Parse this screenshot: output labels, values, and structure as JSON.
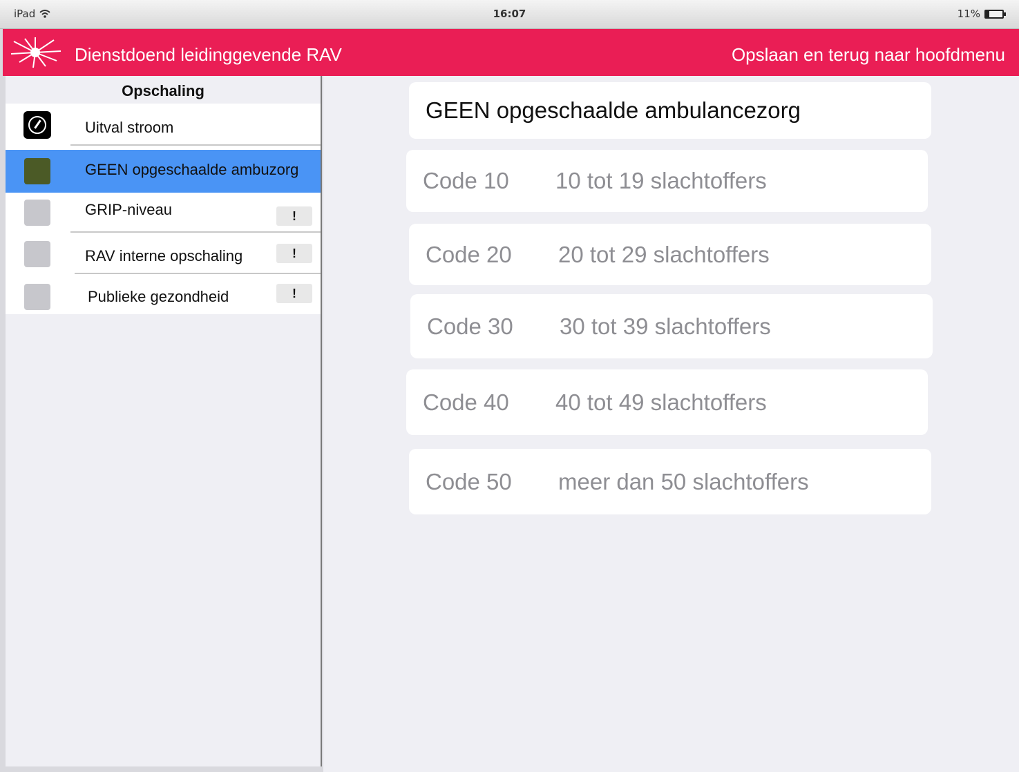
{
  "status_bar": {
    "device": "iPad",
    "time": "16:07",
    "battery": "11%"
  },
  "header": {
    "title": "Dienstdoend leidinggevende RAV",
    "save_back": "Opslaan en terug naar hoofdmenu",
    "accent_color": "#ea1e55"
  },
  "sidebar": {
    "heading": "Opschaling",
    "items": [
      {
        "label": "Uitval stroom",
        "icon": "compass-icon",
        "warning": false,
        "selected": false
      },
      {
        "label": "GEEN opgeschaalde ambuzorg",
        "icon": "olive-square",
        "warning": false,
        "selected": true
      },
      {
        "label": "GRIP-niveau",
        "icon": "gray-square",
        "warning": true,
        "selected": false
      },
      {
        "label": "RAV interne opschaling",
        "icon": "gray-square",
        "warning": true,
        "selected": false
      },
      {
        "label": "Publieke gezondheid",
        "icon": "gray-square",
        "warning": true,
        "selected": false
      }
    ],
    "warning_glyph": "!",
    "selected_color": "#4a94f5"
  },
  "main": {
    "title": "GEEN opgeschaalde ambulancezorg",
    "options": [
      {
        "code": "Code 10",
        "description": "10 tot 19 slachtoffers"
      },
      {
        "code": "Code 20",
        "description": "20 tot 29 slachtoffers"
      },
      {
        "code": "Code 30",
        "description": "30 tot 39 slachtoffers"
      },
      {
        "code": "Code 40",
        "description": "40 tot 49 slachtoffers"
      },
      {
        "code": "Code 50",
        "description": "meer dan 50 slachtoffers"
      }
    ]
  }
}
